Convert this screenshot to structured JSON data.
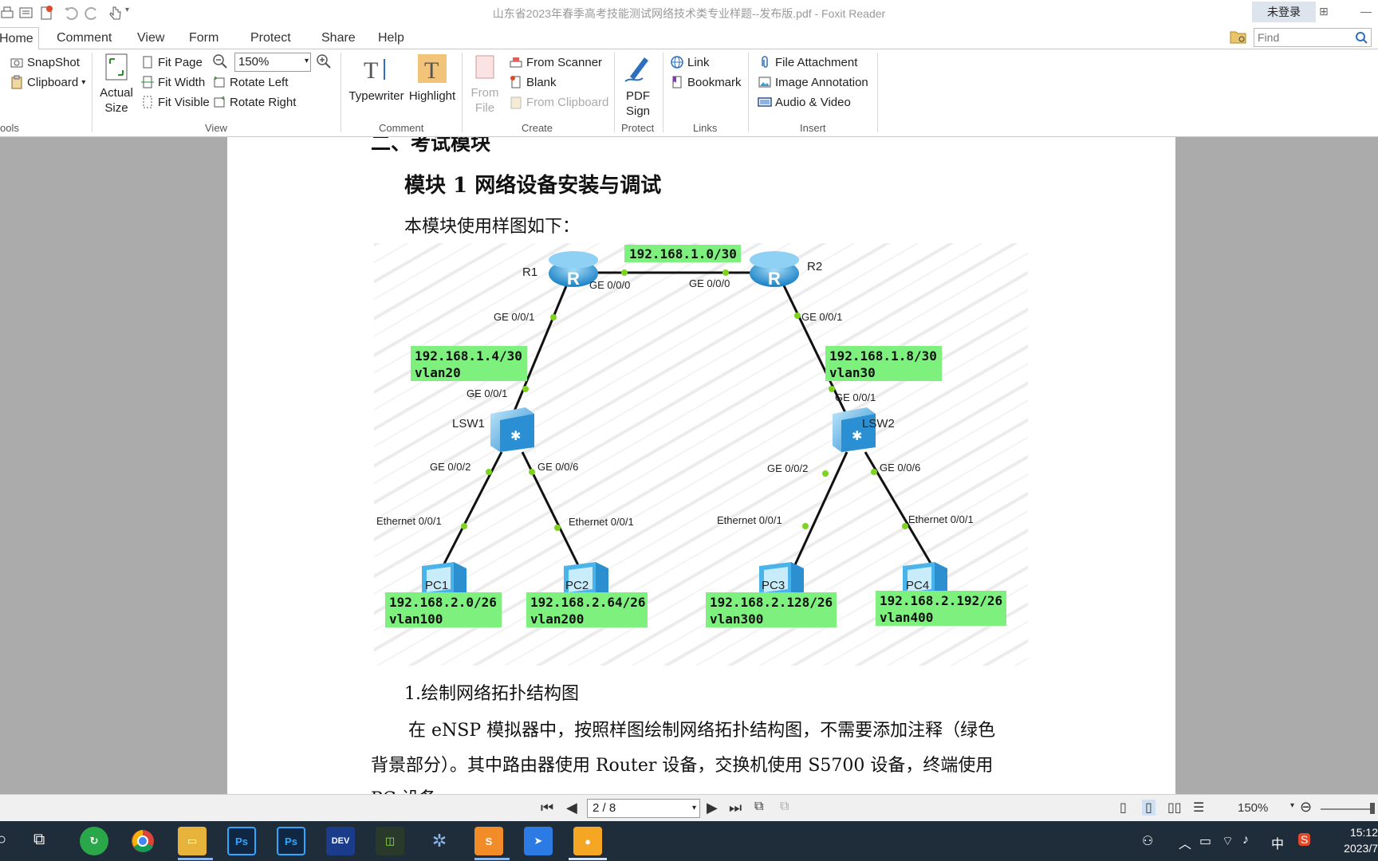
{
  "window": {
    "title": "山东省2023年春季高考技能测试网络技术类专业样题--发布版.pdf - Foxit Reader",
    "login_label": "未登录"
  },
  "menu": {
    "tabs": [
      "Home",
      "Comment",
      "View",
      "Form",
      "Protect",
      "Share",
      "Help"
    ],
    "active_tab": "Home",
    "find_placeholder": "Find"
  },
  "ribbon": {
    "tools": {
      "snapshot": "SnapShot",
      "clipboard": "Clipboard",
      "label": "Tools",
      "label_visible": "ools"
    },
    "view": {
      "actual_size": "Actual Size",
      "fit_page": "Fit Page",
      "fit_width": "Fit Width",
      "fit_visible": "Fit Visible",
      "zoom": "150%",
      "rotate_left": "Rotate Left",
      "rotate_right": "Rotate Right",
      "label": "View"
    },
    "comment": {
      "typewriter": "Typewriter",
      "highlight": "Highlight",
      "label": "Comment"
    },
    "create": {
      "from_file": "From File",
      "from_scanner": "From Scanner",
      "blank": "Blank",
      "from_clipboard": "From Clipboard",
      "label": "Create"
    },
    "protect": {
      "pdf_sign": "PDF Sign",
      "label": "Protect"
    },
    "links": {
      "link": "Link",
      "bookmark": "Bookmark",
      "label": "Links"
    },
    "insert": {
      "file_attachment": "File Attachment",
      "image_annotation": "Image Annotation",
      "audio_video": "Audio & Video",
      "label": "Insert"
    }
  },
  "document": {
    "cut_heading": "二、考试模块",
    "module_title": "模块 1  网络设备安装与调试",
    "intro": "本模块使用样图如下：",
    "section1": "1.绘制网络拓扑结构图",
    "para_line1": "在 eNSP 模拟器中，按照样图绘制网络拓扑结构图，不需要添加注释（绿色",
    "para_line2": "背景部分）。其中路由器使用 Router 设备，交换机使用 S5700 设备，终端使用",
    "para_line3": "PC 设备。"
  },
  "topology": {
    "devices": {
      "r1": "R1",
      "r2": "R2",
      "lsw1": "LSW1",
      "lsw2": "LSW2",
      "pc1": "PC1",
      "pc2": "PC2",
      "pc3": "PC3",
      "pc4": "PC4"
    },
    "ports": {
      "r1_ge000": "GE 0/0/0",
      "r2_ge000": "GE 0/0/0",
      "r1_ge001": "GE 0/0/1",
      "r2_ge001": "GE 0/0/1",
      "lsw1_ge001": "GE 0/0/1",
      "lsw2_ge001": "GE 0/0/1",
      "lsw1_ge002": "GE 0/0/2",
      "lsw1_ge006": "GE 0/0/6",
      "lsw2_ge002": "GE 0/0/2",
      "lsw2_ge006": "GE 0/0/6",
      "pc1_eth": "Ethernet 0/0/1",
      "pc2_eth": "Ethernet 0/0/1",
      "pc3_eth": "Ethernet 0/0/1",
      "pc4_eth": "Ethernet 0/0/1"
    },
    "nets": {
      "r1r2": "192.168.1.0/30",
      "r1_lsw1_ip": "192.168.1.4/30",
      "r1_lsw1_vlan": "vlan20",
      "r2_lsw2_ip": "192.168.1.8/30",
      "r2_lsw2_vlan": "vlan30",
      "pc1_ip": "192.168.2.0/26",
      "pc1_vlan": "vlan100",
      "pc2_ip": "192.168.2.64/26",
      "pc2_vlan": "vlan200",
      "pc3_ip": "192.168.2.128/26",
      "pc3_vlan": "vlan300",
      "pc4_ip": "192.168.2.192/26",
      "pc4_vlan": "vlan400"
    },
    "colors": {
      "label_bg": "#7ef07e",
      "link": "#111111",
      "port_dot": "#7ed321",
      "router": "#3a9fd8",
      "switch": "#3fa6e0",
      "pc": "#4ab3ea"
    }
  },
  "status": {
    "page": "2 / 8",
    "zoom": "150%"
  },
  "taskbar": {
    "apps": [
      "chrome",
      "file-explorer",
      "photoshop",
      "photoshop",
      "dev-cpp",
      "pixel-editor",
      "ensp",
      "pdf-reader",
      "message",
      "recorder"
    ],
    "apps_visible": [
      "Ps",
      "Ps",
      "DEV",
      "S"
    ],
    "clock_time": "15:12",
    "clock_date": "2023/7",
    "ime": "中"
  }
}
